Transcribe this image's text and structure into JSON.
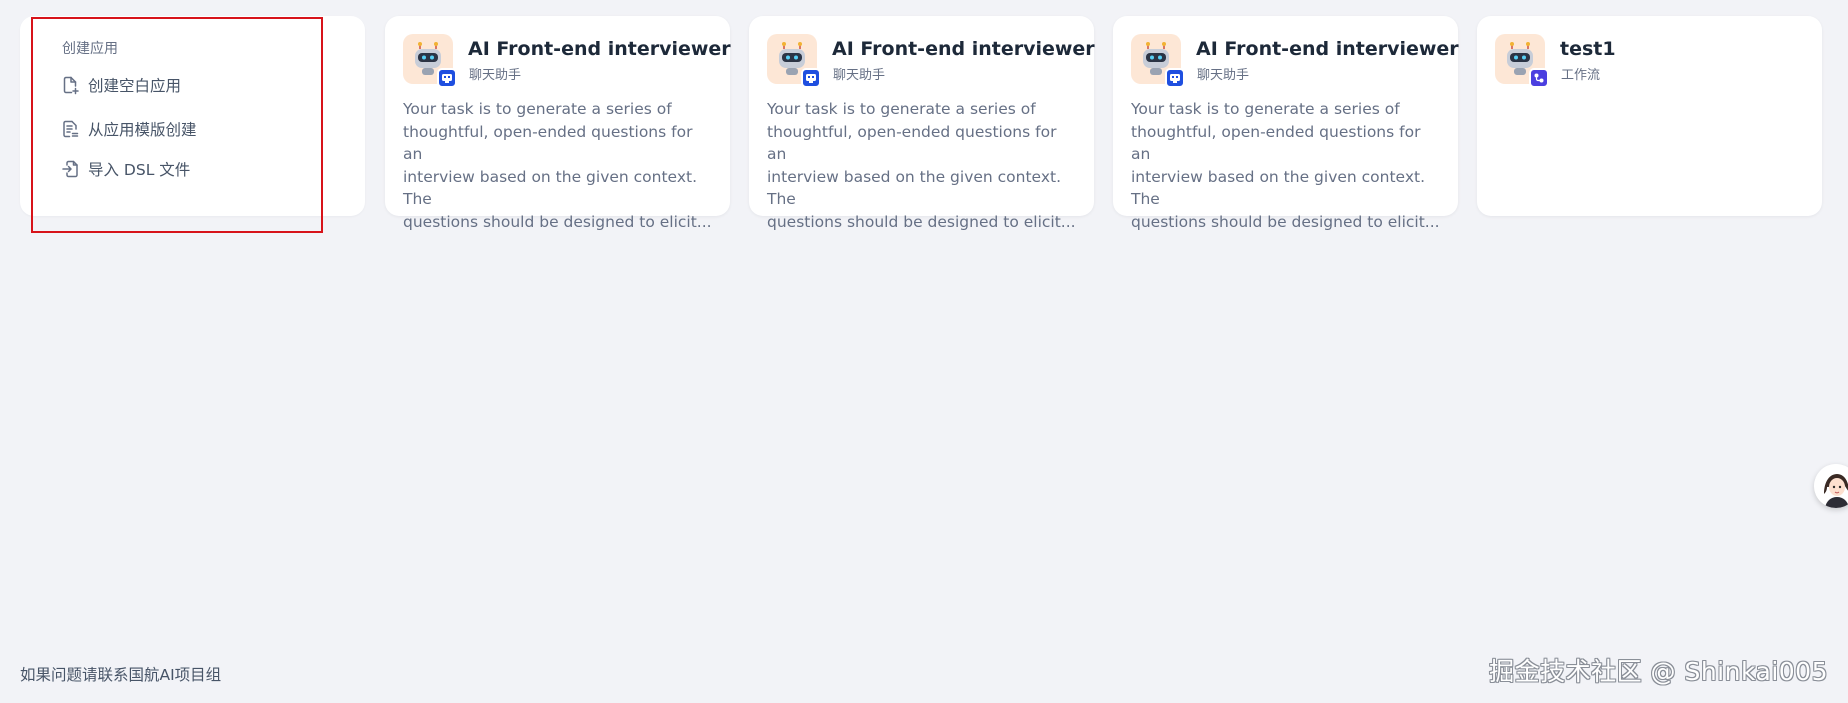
{
  "create_menu": {
    "title": "创建应用",
    "options": [
      {
        "label": "创建空白应用",
        "icon": "file-plus-icon"
      },
      {
        "label": "从应用模版创建",
        "icon": "file-text-icon"
      },
      {
        "label": "导入 DSL 文件",
        "icon": "file-import-icon"
      }
    ]
  },
  "apps": [
    {
      "name": "AI Front-end interviewer",
      "type": "聊天助手",
      "description": "Your task is to generate a series of\nthoughtful, open-ended questions for an\ninterview based on the given context. The\nquestions should be designed to elicit...",
      "icon": "robot-icon",
      "badge": "chat-badge-icon"
    },
    {
      "name": "AI Front-end interviewer",
      "type": "聊天助手",
      "description": "Your task is to generate a series of\nthoughtful, open-ended questions for an\ninterview based on the given context. The\nquestions should be designed to elicit...",
      "icon": "robot-icon",
      "badge": "chat-badge-icon"
    },
    {
      "name": "AI Front-end interviewer",
      "type": "聊天助手",
      "description": "Your task is to generate a series of\nthoughtful, open-ended questions for an\ninterview based on the given context. The\nquestions should be designed to elicit...",
      "icon": "robot-icon",
      "badge": "chat-badge-icon"
    },
    {
      "name": "test1",
      "type": "工作流",
      "description": "",
      "icon": "robot-icon",
      "badge": "workflow-badge-icon"
    }
  ],
  "footer": {
    "note": "如果问题请联系国航AI项目组"
  },
  "watermark": "掘金技术社区 @ Shinkai005",
  "colors": {
    "background": "#f2f3f7",
    "card": "#ffffff",
    "accent": "#1f4fe0",
    "highlight_border": "#d7131a",
    "icon_background": "#fde7d6"
  }
}
